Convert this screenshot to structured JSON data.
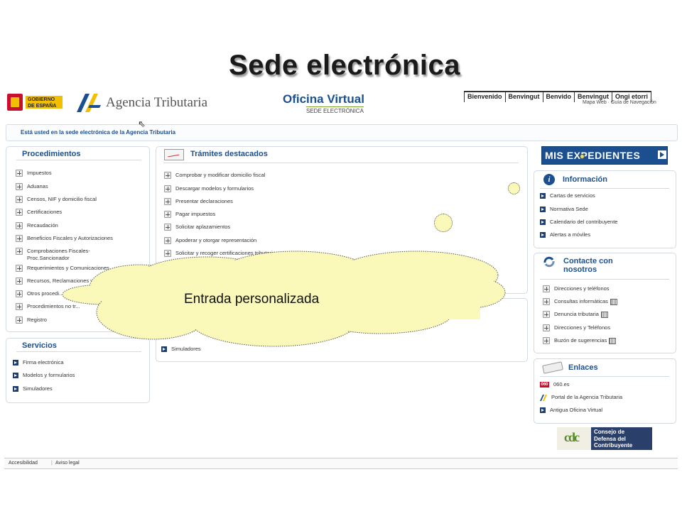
{
  "slide_title": "Sede electrónica",
  "header": {
    "gobierno_text": "GOBIERNO\nDE ESPAÑA",
    "agencia_text": "Agencia Tributaria",
    "oficina_title": "Oficina Virtual",
    "oficina_sub": "SEDE ELECTRÓNICA",
    "languages": [
      "Bienvenido",
      "Benvingut",
      "Benvido",
      "Benvingut",
      "Ongi etorri"
    ],
    "top_links": "Mapa Web · Guía de Navegación",
    "sede_notice": "Está usted en la sede electrónica de la Agencia Tributaria"
  },
  "procedimientos": {
    "title": "Procedimientos",
    "items": [
      "Impuestos",
      "Aduanas",
      "Censos, NIF y domicilio fiscal",
      "Certificaciones",
      "Recaudación",
      "Beneficios Fiscales y Autorizaciones",
      "Comprobaciones Fiscales-\nProc.Sancionador",
      "Requerimientos y Comunicaciones",
      "Recursos, Reclamaciones y ...",
      "Otros procedi...",
      "Procedimientos no tr...",
      "Registro"
    ]
  },
  "servicios": {
    "title": "Servicios",
    "items": [
      "Firma electrónica",
      "Modelos y formularios",
      "Simuladores"
    ]
  },
  "tramites": {
    "title": "Trámites destacados",
    "items": [
      "Comprobar y modificar domicilio fiscal",
      "Descargar modelos y formularios",
      "Presentar declaraciones",
      "Pagar impuestos",
      "Solicitar aplazamientos",
      "Apoderar y otorgar representación",
      "Solicitar y recoger certificaciones tributarias"
    ],
    "simuladores": "Simuladores"
  },
  "mis_expedientes": "MIS EXPEDIENTES",
  "informacion": {
    "title": "Información",
    "items": [
      "Cartas de servicios",
      "Normativa Sede",
      "Calendario del contribuyente",
      "Alertas a móviles"
    ]
  },
  "contacte": {
    "title": "Contacte con\nnosotros",
    "items": [
      "Direcciones y teléfonos",
      "Consultas informáticas",
      "Denuncia tributaria",
      "Direcciones y Teléfonos",
      "Buzón de sugerencias"
    ]
  },
  "enlaces": {
    "title": "Enlaces",
    "items": [
      "060.es",
      "Portal de la Agencia Tributaria",
      "Antigua Oficina Virtual"
    ],
    "badge_060": "060"
  },
  "consejo": {
    "logo_letters": "cdc",
    "text": "Consejo de\nDefensa del\nContribuyente"
  },
  "footer": {
    "accesibilidad": "Accesibilidad",
    "aviso_legal": "Aviso legal"
  },
  "callout": "Entrada personalizada",
  "colors": {
    "brand_blue": "#1c4f8f",
    "callout_fill": "#fbf9ba"
  }
}
